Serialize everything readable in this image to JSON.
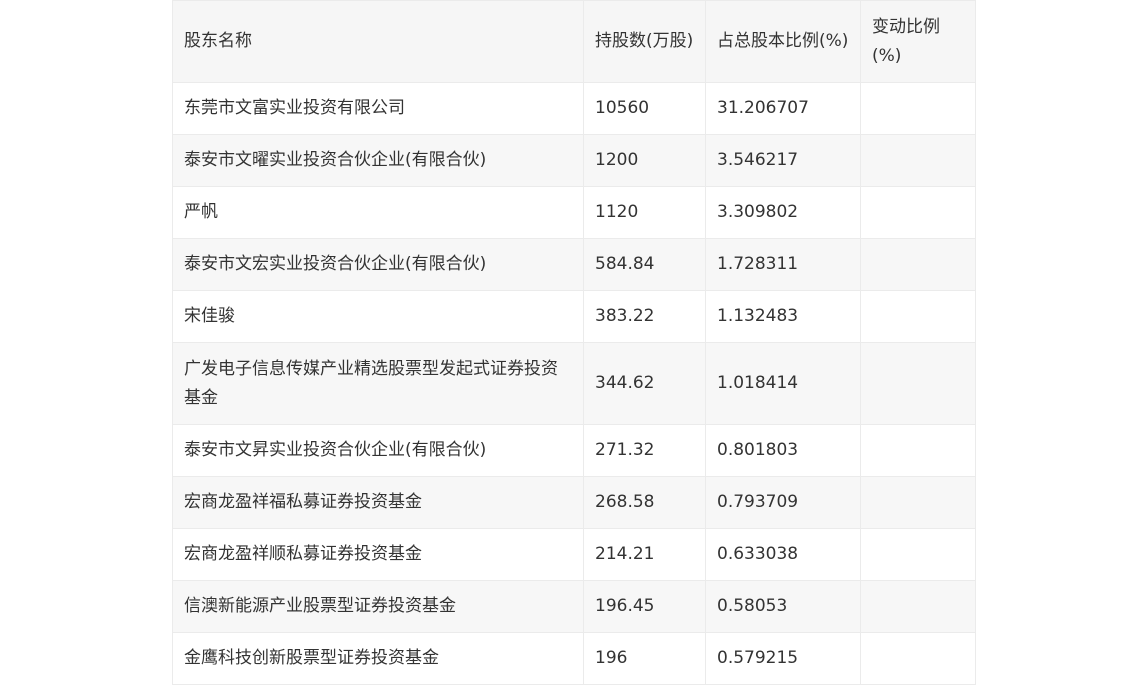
{
  "table": {
    "headers": [
      "股东名称",
      "持股数(万股)",
      "占总股本比例(%)",
      "变动比例(%)"
    ],
    "rows": [
      {
        "name": "东莞市文富实业投资有限公司",
        "shares": "10560",
        "ratio": "31.206707",
        "change": ""
      },
      {
        "name": "泰安市文曜实业投资合伙企业(有限合伙)",
        "shares": "1200",
        "ratio": "3.546217",
        "change": ""
      },
      {
        "name": "严帆",
        "shares": "1120",
        "ratio": "3.309802",
        "change": ""
      },
      {
        "name": "泰安市文宏实业投资合伙企业(有限合伙)",
        "shares": "584.84",
        "ratio": "1.728311",
        "change": ""
      },
      {
        "name": "宋佳骏",
        "shares": "383.22",
        "ratio": "1.132483",
        "change": ""
      },
      {
        "name": "广发电子信息传媒产业精选股票型发起式证券投资基金",
        "shares": "344.62",
        "ratio": "1.018414",
        "change": ""
      },
      {
        "name": "泰安市文昇实业投资合伙企业(有限合伙)",
        "shares": "271.32",
        "ratio": "0.801803",
        "change": ""
      },
      {
        "name": "宏商龙盈祥福私募证券投资基金",
        "shares": "268.58",
        "ratio": "0.793709",
        "change": ""
      },
      {
        "name": "宏商龙盈祥顺私募证券投资基金",
        "shares": "214.21",
        "ratio": "0.633038",
        "change": ""
      },
      {
        "name": "信澳新能源产业股票型证券投资基金",
        "shares": "196.45",
        "ratio": "0.58053",
        "change": ""
      },
      {
        "name": "金鹰科技创新股票型证券投资基金",
        "shares": "196",
        "ratio": "0.579215",
        "change": ""
      }
    ]
  }
}
